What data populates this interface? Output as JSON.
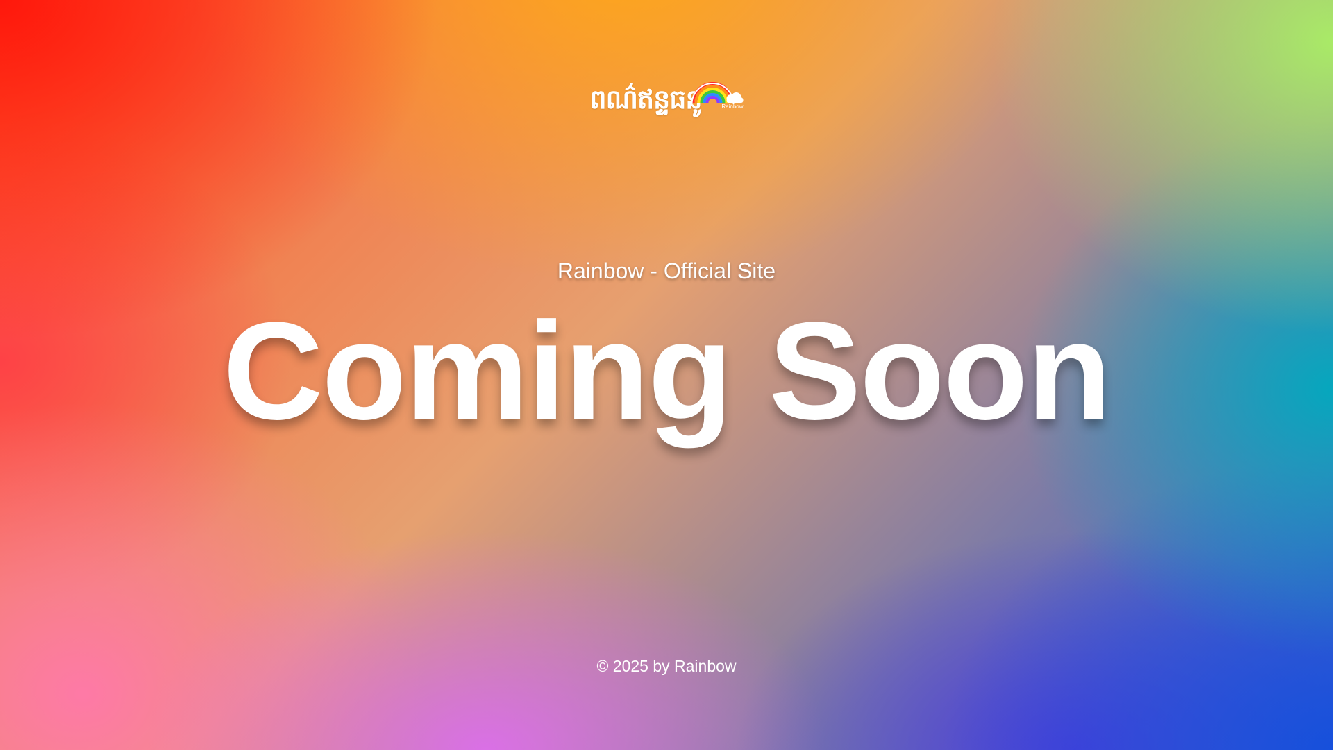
{
  "logo": {
    "khmer_text": "ពណ៌ឥន្ទធនូ",
    "mark_label": "Rainbow",
    "icon": "rainbow-cloud-icon"
  },
  "hero": {
    "subtitle": "Rainbow - Official Site",
    "headline": "Coming Soon"
  },
  "footer": {
    "copyright": "© 2025 by Rainbow"
  },
  "colors": {
    "text": "#ffffff",
    "top_left": "#ff1a0a",
    "top_center": "#ffaa14",
    "top_right": "#aaf064",
    "right_middle": "#00aabe",
    "bottom_right": "#1450dc",
    "bottom_center": "#dc6eeb",
    "bottom_left": "#ff78aa"
  }
}
